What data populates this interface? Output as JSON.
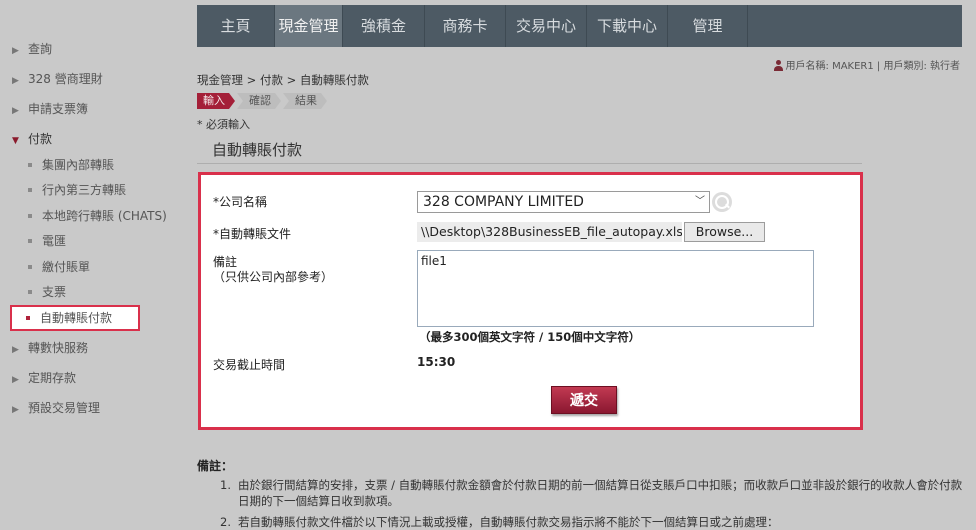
{
  "sidebar": {
    "items": [
      {
        "label": "查詢"
      },
      {
        "label": "328 營商理財"
      },
      {
        "label": "申請支票簿"
      },
      {
        "label": "付款"
      },
      {
        "label": "轉數快服務"
      },
      {
        "label": "定期存款"
      },
      {
        "label": "預設交易管理"
      }
    ],
    "sub_items": [
      {
        "label": "集團內部轉賬"
      },
      {
        "label": "行內第三方轉賬"
      },
      {
        "label": "本地跨行轉賬 (CHATS)"
      },
      {
        "label": "電匯"
      },
      {
        "label": "繳付賬單"
      },
      {
        "label": "支票"
      },
      {
        "label": "自動轉賬付款"
      }
    ]
  },
  "topnav": {
    "tabs": [
      {
        "label": "主頁"
      },
      {
        "label": "現金管理"
      },
      {
        "label": "強積金"
      },
      {
        "label": "商務卡"
      },
      {
        "label": "交易中心"
      },
      {
        "label": "下載中心"
      },
      {
        "label": "管理"
      }
    ]
  },
  "user": {
    "text": "用戶名稱: MAKER1 | 用戶類別: 執行者"
  },
  "breadcrumb": "現金管理 > 付款 > 自動轉賬付款",
  "steps": [
    "輸入",
    "確認",
    "結果"
  ],
  "required_note": "* 必須輸入",
  "section_title": "自動轉賬付款",
  "form": {
    "company_label": "*公司名稱",
    "company_value": "328 COMPANY LIMITED",
    "file_label": "*自動轉賬文件",
    "file_value": "\\\\Desktop\\328BusinessEB_file_autopay.xls",
    "browse_label": "Browse...",
    "remarks_label": "備註",
    "remarks_sub_label": "（只供公司內部參考）",
    "remarks_value": "file1",
    "char_limit": "（最多300個英文字符 / 150個中文字符）",
    "cutoff_label": "交易截止時間",
    "cutoff_value": "15:30",
    "submit_label": "遞交"
  },
  "notes": {
    "title": "備註：",
    "items": [
      {
        "num": "1.",
        "text": "由於銀行間結算的安排，支票 / 自動轉賬付款金額會於付款日期的前一個結算日從支賬戶口中扣賬；而收款戶口並非設於銀行的收款人會於付款日期的下一個結算日收到款項。"
      },
      {
        "num": "2.",
        "text": "若自動轉賬付款文件檔於以下情況上載或授權，自動轉賬付款交易指示將不能於下一個結算日或之前處理："
      }
    ]
  },
  "colors": {
    "accent": "#d9304b",
    "nav_bg": "#4d5a64",
    "button": "#a41f38"
  }
}
